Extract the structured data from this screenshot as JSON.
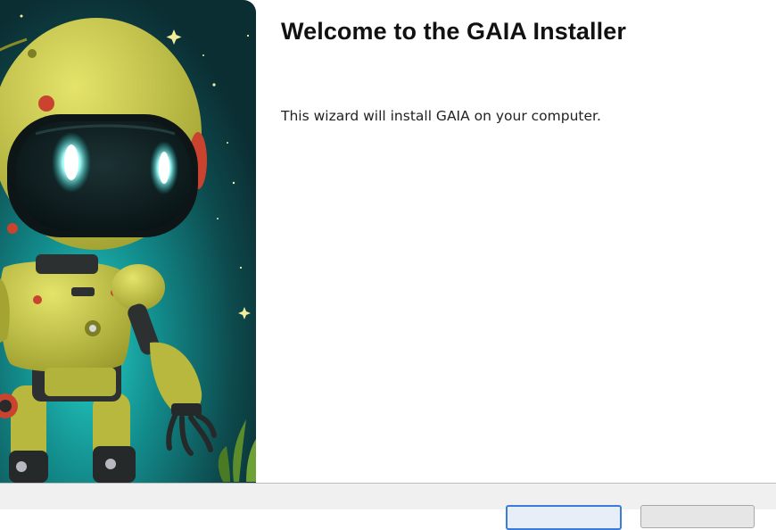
{
  "wizard": {
    "title": "Welcome to the GAIA Installer",
    "description": "This wizard will install GAIA on your computer."
  },
  "banner": {
    "image": "robot-illustration",
    "colors": {
      "sky": "#0f3a3e",
      "glow": "#19c2bd",
      "robot": "#c8c94a",
      "visor": "#0c1a1c",
      "eyes": "#9ff8f5"
    }
  },
  "buttons": {
    "next_label": "",
    "cancel_label": ""
  },
  "colors": {
    "focus_border": "#3b7bd9",
    "bar": "#f0f0f0"
  }
}
